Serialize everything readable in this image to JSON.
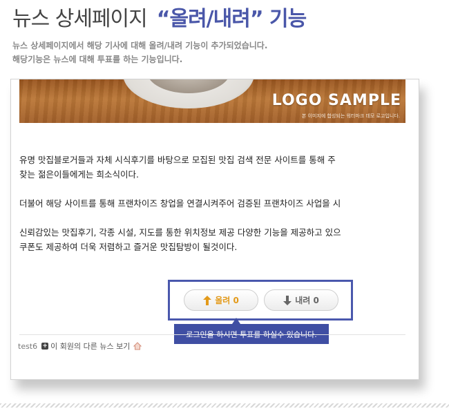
{
  "header": {
    "title_main": "뉴스 상세페이지",
    "title_accent": "“올려/내려” 기능",
    "desc_line1": "뉴스 상세페이지에서 해당 기사에 대해 올려/내려 기능이 추가되었습니다.",
    "desc_line2": "해당기능은 뉴스에 대해 투표를 하는 기능입니다."
  },
  "hero": {
    "logo_text": "LOGO SAMPLE",
    "logo_sub": "본 이미지에 합성되는 워터마크 데모 로고입니다."
  },
  "article": {
    "paragraphs": [
      [
        "유명 맛집블로거들과 자체 시식후기를 바탕으로 모집된 맛집 검색 전문 사이트를 통해 주",
        "찾는 젊은이들에게는 희소식이다."
      ],
      [
        "더불어 해당 사이트를 통해 프랜차이즈 창업을 연결시켜주어 검증된 프랜차이즈 사업을 시"
      ],
      [
        "신뢰감있는 맛집후기, 각종 시설, 지도를 통한 위치정보 제공 다양한 기능을 제공하고 있으",
        "쿠폰도 제공하여 더욱 저렴하고 즐거운 맛집탐방이 될것이다."
      ]
    ]
  },
  "vote": {
    "up_label": "올려 0",
    "down_label": "내려 0",
    "tooltip": "로그인을 하시면 투표를 하실수 있습니다.",
    "colors": {
      "border": "#4a58ad",
      "up": "#e39a1a",
      "tooltip_bg": "#3f4ea3"
    }
  },
  "author": {
    "name": "test6",
    "other_news_link": "이 회원의 다른 뉴스 보기"
  },
  "icons": {
    "up": "arrow-up-icon",
    "down": "arrow-down-icon",
    "plus": "plus-icon",
    "home": "home-icon"
  }
}
